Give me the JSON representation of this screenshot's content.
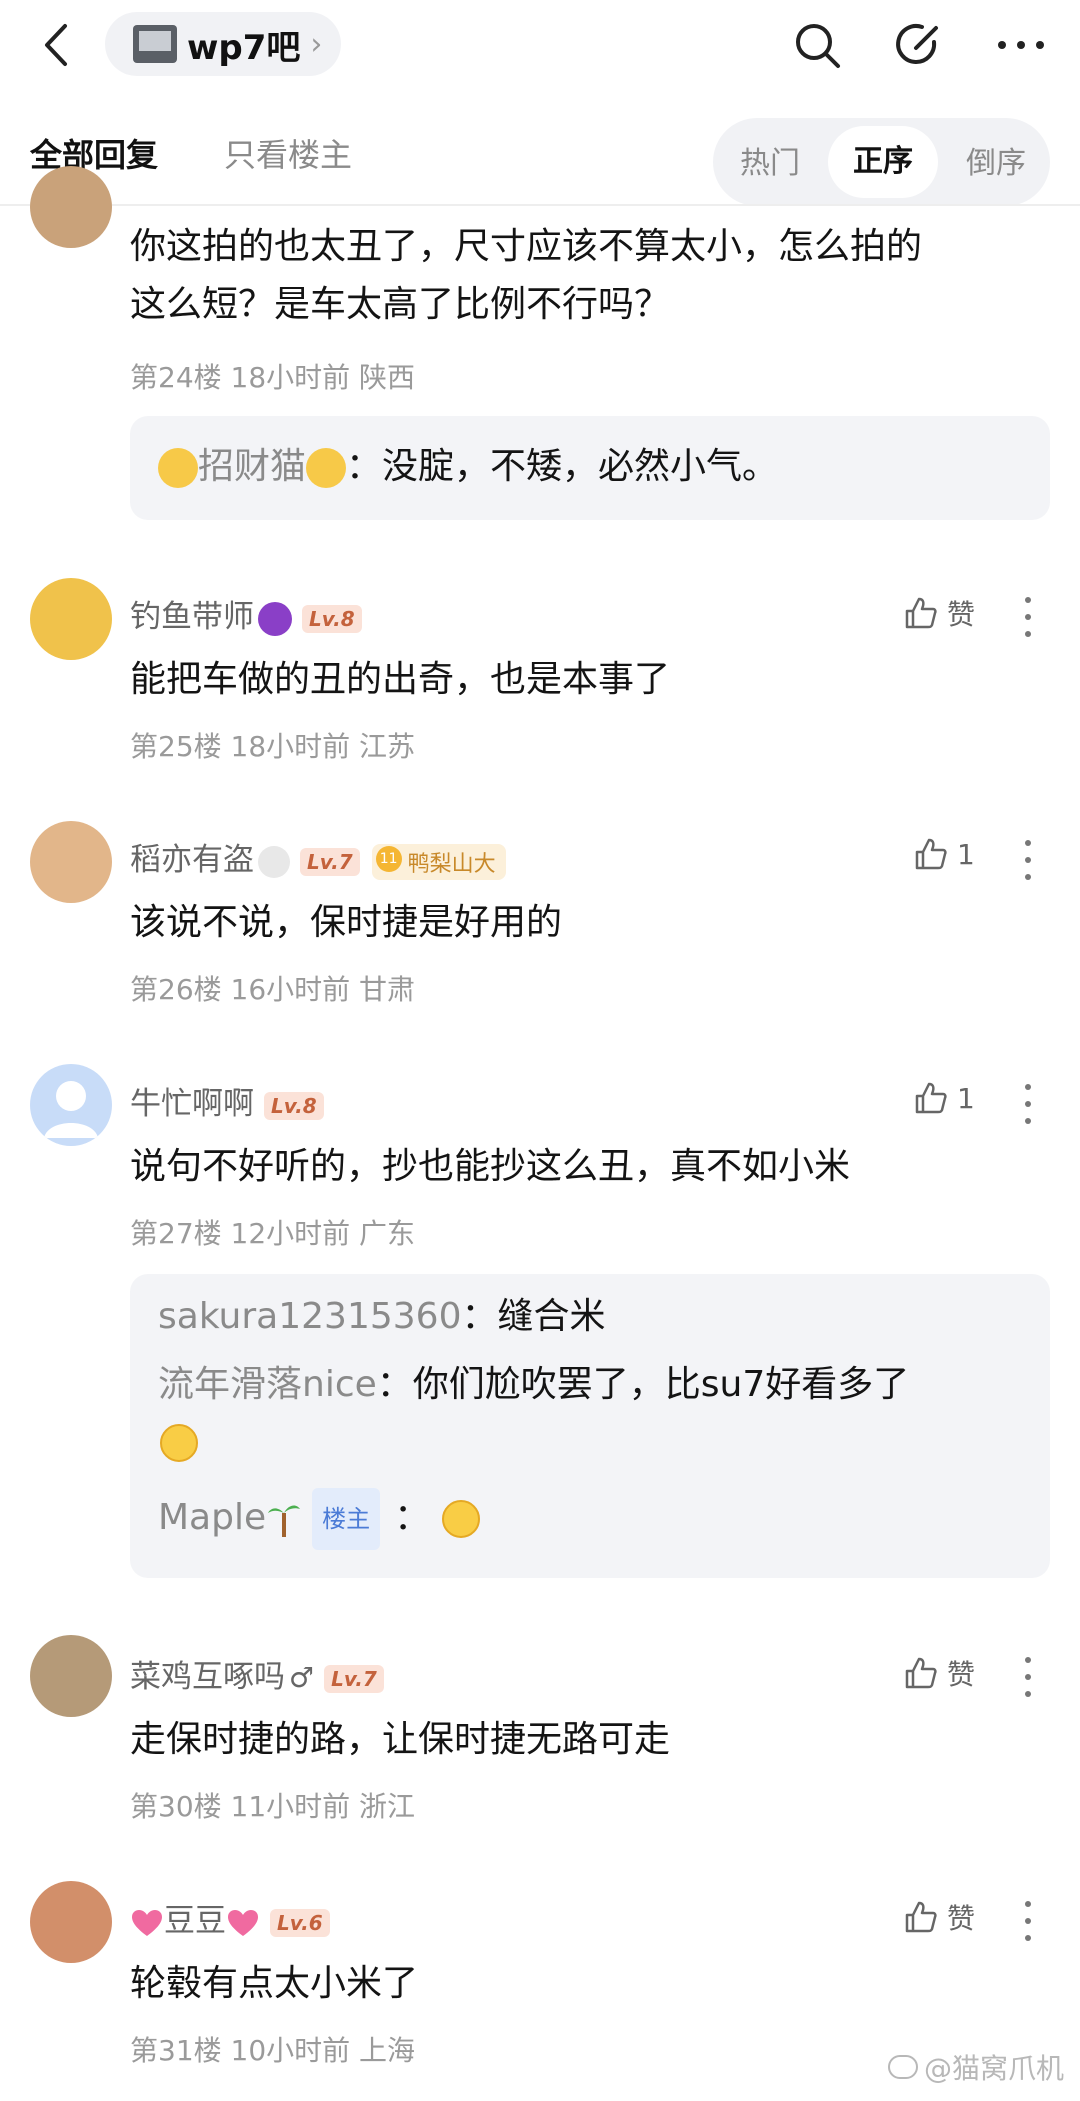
{
  "header": {
    "forum_name": "wp7吧",
    "chevron": "›"
  },
  "filter": {
    "all_replies": "全部回复",
    "only_op": "只看楼主",
    "sort": [
      "热门",
      "正序",
      "倒序"
    ],
    "active_sort": "正序"
  },
  "comments": [
    {
      "text_lines": [
        "你这拍的也太丑了，尺寸应该不算太小，怎么拍的",
        "这么短？是车太高了比例不行吗？"
      ],
      "meta": "第24楼 18小时前 陕西",
      "reply": {
        "name": "招财猫",
        "text": "：没腚，不矮，必然小气。"
      }
    },
    {
      "username": "钓鱼带师",
      "level": "Lv.8",
      "like": "赞",
      "text": "能把车做的丑的出奇，也是本事了",
      "meta": "第25楼 18小时前 江苏"
    },
    {
      "username": "稻亦有盗",
      "level": "Lv.7",
      "badge": "鸭梨山大",
      "like": "1",
      "text": "该说不说，保时捷是好用的",
      "meta": "第26楼 16小时前 甘肃"
    },
    {
      "username": "牛忙啊啊",
      "level": "Lv.8",
      "like": "1",
      "text": "说句不好听的，抄也能抄这么丑，真不如小米",
      "meta": "第27楼 12小时前 广东",
      "replies": [
        {
          "name": "sakura12315360",
          "text": "：缝合米"
        },
        {
          "name": "流年滑落nice",
          "text": "：你们尬吹罢了，比su7好看多了"
        },
        {
          "name": "Maple",
          "tag": "楼主",
          "text": "："
        }
      ]
    },
    {
      "username": "菜鸡互啄吗",
      "level": "Lv.7",
      "like": "赞",
      "text": "走保时捷的路，让保时捷无路可走",
      "meta": "第30楼 11小时前 浙江"
    },
    {
      "username": "豆豆",
      "level": "Lv.6",
      "like": "赞",
      "text": "轮毂有点太小米了",
      "meta": "第31楼 10小时前 上海"
    }
  ],
  "watermark": "@猫窝爪机",
  "colors": {
    "level_badge": "#c4623c",
    "host_tag": "#4b7bd6",
    "meta": "#9a9a9a"
  }
}
